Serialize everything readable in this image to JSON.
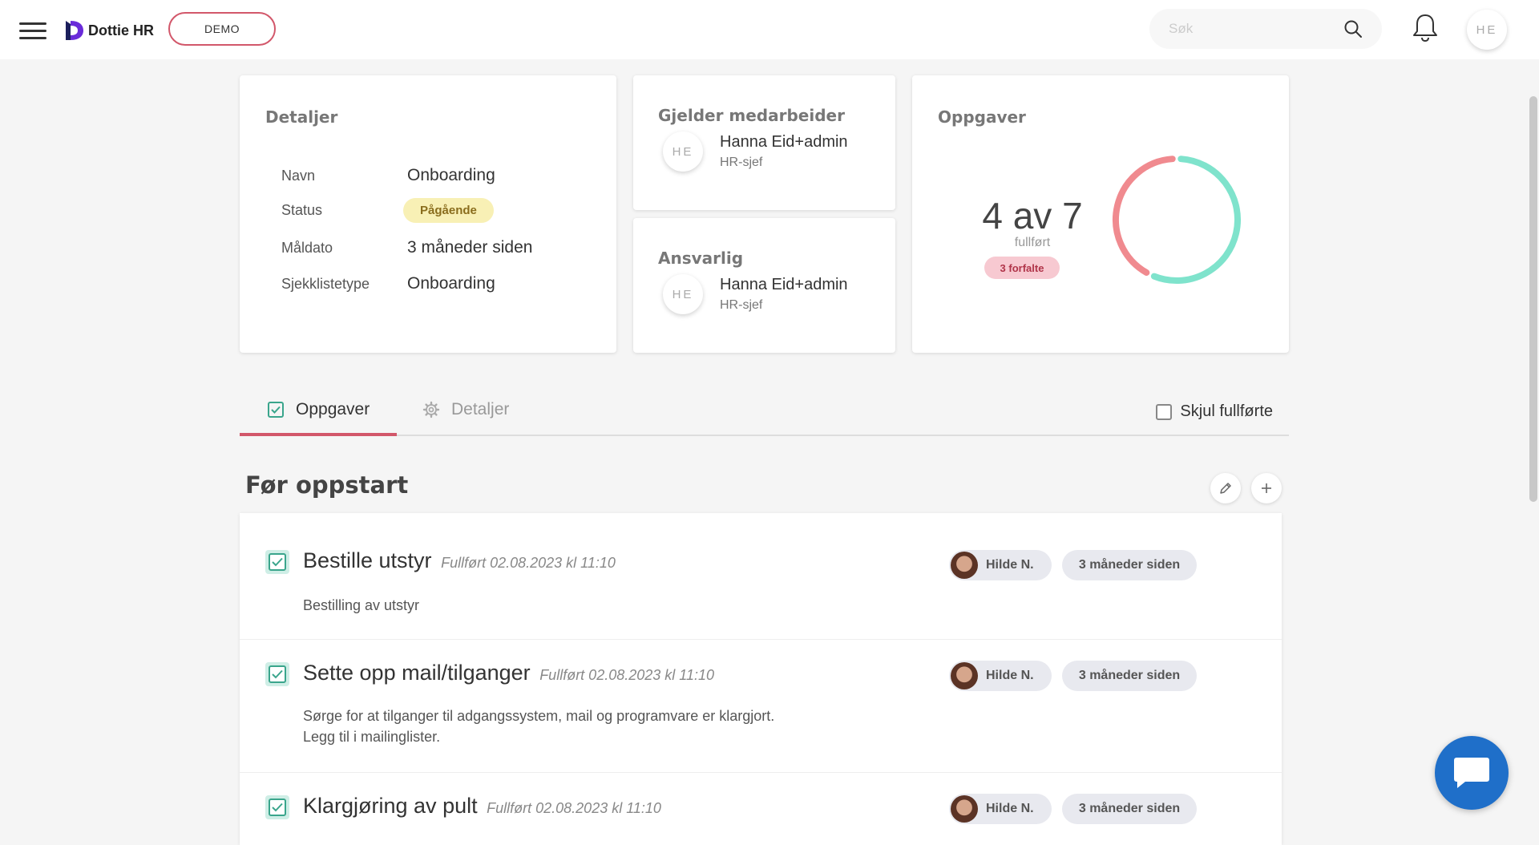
{
  "header": {
    "brand": "Dottie HR",
    "demo_label": "DEMO",
    "search_placeholder": "Søk",
    "user_initials": "HE"
  },
  "details_card": {
    "title": "Detaljer",
    "rows": [
      {
        "label": "Navn",
        "value": "Onboarding"
      },
      {
        "label": "Status",
        "value": "Pågående"
      },
      {
        "label": "Måldato",
        "value": "3 måneder siden"
      },
      {
        "label": "Sjekklistetype",
        "value": "Onboarding"
      }
    ]
  },
  "employee_card": {
    "title": "Gjelder medarbeider",
    "initials": "HE",
    "name": "Hanna Eid+admin",
    "role": "HR-sjef"
  },
  "responsible_card": {
    "title": "Ansvarlig",
    "initials": "HE",
    "name": "Hanna Eid+admin",
    "role": "HR-sjef"
  },
  "tasks_card": {
    "title": "Oppgaver",
    "count_text": "4 av 7",
    "sub_text": "fullført",
    "overdue_text": "3 forfalte",
    "completed": 4,
    "overdue": 3,
    "total": 7,
    "colors": {
      "completed": "#7fe3cc",
      "overdue": "#f08a8f"
    }
  },
  "tabs": [
    {
      "label": "Oppgaver",
      "active": true
    },
    {
      "label": "Detaljer",
      "active": false
    }
  ],
  "hide_completed_label": "Skjul fullførte",
  "section": {
    "title": "Før oppstart",
    "tasks": [
      {
        "title": "Bestille utstyr",
        "completed_text": "Fullført 02.08.2023 kl 11:10",
        "description": [
          "Bestilling av utstyr"
        ],
        "assignee": "Hilde N.",
        "due": "3 måneder siden"
      },
      {
        "title": "Sette opp mail/tilganger",
        "completed_text": "Fullført 02.08.2023 kl 11:10",
        "description": [
          "Sørge for at tilganger til adgangssystem, mail og programvare er klargjort.",
          "Legg til i mailinglister."
        ],
        "assignee": "Hilde N.",
        "due": "3 måneder siden"
      },
      {
        "title": "Klargjøring av pult",
        "completed_text": "Fullført 02.08.2023 kl 11:10",
        "description": [],
        "assignee": "Hilde N.",
        "due": "3 måneder siden"
      }
    ]
  },
  "colors": {
    "accent": "#d2576a",
    "chat": "#1f6fc9",
    "check": "#3aa58c"
  }
}
